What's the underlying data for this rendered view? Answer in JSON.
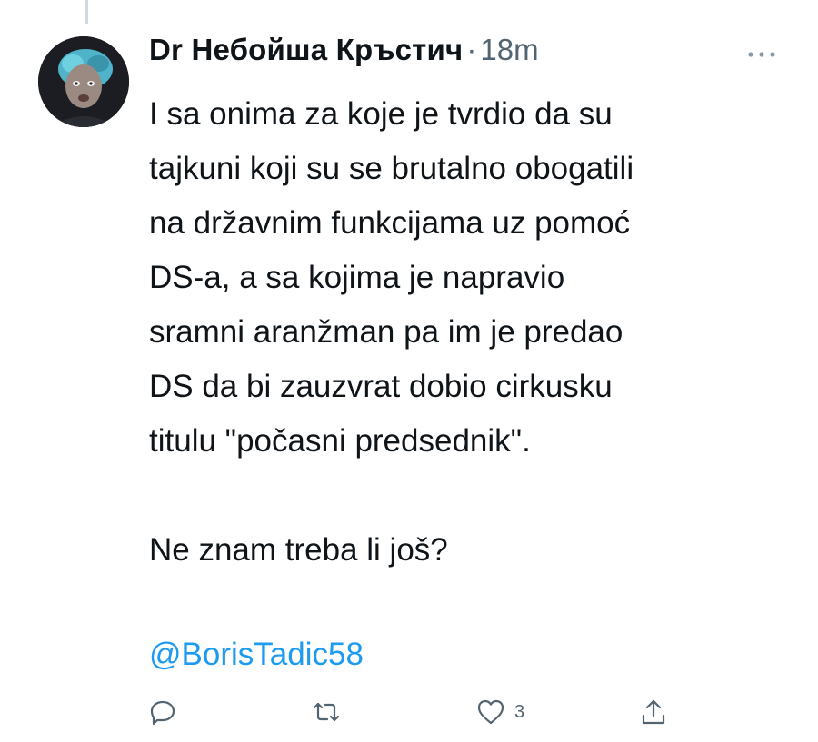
{
  "tweet": {
    "author_name": "Dr Небойша Кръстич",
    "separator": "·",
    "timestamp": "18m",
    "text": "I sa onima za koje je tvrdio da su\ntajkuni koji su se brutalno obogatili\nna državnim funkcijama uz pomoć\nDS-a, a sa kojima je napravio\nsramni aranžman pa im je predao\nDS da bi zauzvrat dobio cirkusku\ntitulu \"počasni predsednik\".\n\nNe znam treba li još?",
    "mention": "@BorisTadic58"
  },
  "actions": {
    "reply_icon": "comment-icon",
    "retweet_icon": "retweet-icon",
    "like_icon": "heart-icon",
    "like_count": "3",
    "share_icon": "share-icon"
  },
  "colors": {
    "text": "#0f1419",
    "secondary": "#536471",
    "link": "#1d9bf0",
    "thread_line": "#cfd9de"
  }
}
